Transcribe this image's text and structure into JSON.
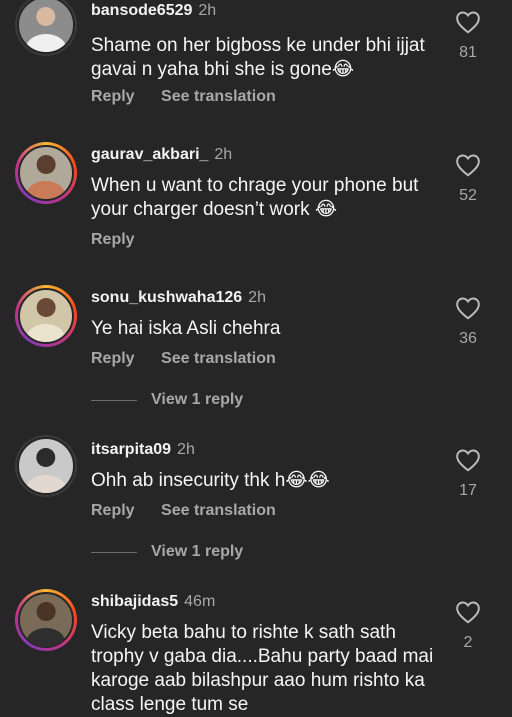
{
  "comments": [
    {
      "username": "bansode6529",
      "time": "2h",
      "text": "Shame on her bigboss ke under bhi ijjat gavai n yaha bhi she is gone😂",
      "reply_label": "Reply",
      "translate_label": "See translation",
      "likes": "81",
      "avatar_ring": false
    },
    {
      "username": "gaurav_akbari_",
      "time": "2h",
      "text": "When u want to chrage your phone but your charger doesn’t work 😂",
      "reply_label": "Reply",
      "likes": "52",
      "avatar_ring": true
    },
    {
      "username": "sonu_kushwaha126",
      "time": "2h",
      "text": "Ye hai iska Asli chehra",
      "reply_label": "Reply",
      "translate_label": "See translation",
      "likes": "36",
      "view_replies": "View 1 reply",
      "avatar_ring": true
    },
    {
      "username": "itsarpita09",
      "time": "2h",
      "text": "Ohh ab insecurity thk h😂😂",
      "reply_label": "Reply",
      "translate_label": "See translation",
      "likes": "17",
      "view_replies": "View 1 reply",
      "avatar_ring": false
    },
    {
      "username": "shibajidas5",
      "time": "46m",
      "text": "Vicky beta bahu to rishte k sath sath trophy v gaba dia....Bahu party baad mai karoge aab bilashpur aao hum rishto ka class lenge tum se",
      "likes": "2",
      "avatar_ring": true
    }
  ],
  "colors": {
    "background": "#262626",
    "secondary_text": "#a8a8a8",
    "primary_text": "#f5f5f5"
  },
  "icons": {
    "like": "heart-outline-icon"
  }
}
